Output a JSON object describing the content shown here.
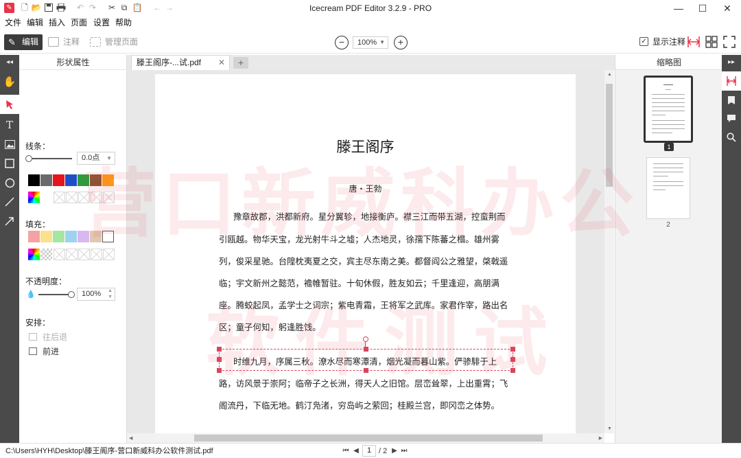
{
  "titlebar": {
    "title": "Icecream PDF Editor 3.2.9 - PRO",
    "logo_glyph": "✎",
    "quick_actions": [
      "new-file-icon",
      "open-folder-icon",
      "save-icon",
      "print-icon",
      "undo-icon",
      "redo-icon",
      "cut-icon",
      "copy-icon",
      "paste-icon",
      "back-icon",
      "forward-icon"
    ],
    "window_buttons": [
      "minimize-icon",
      "maximize-icon",
      "close-icon"
    ]
  },
  "menu": [
    "文件",
    "编辑",
    "插入",
    "页面",
    "设置",
    "帮助"
  ],
  "toolbar": {
    "edit_label": "编辑",
    "annotate_label": "注释",
    "manage_pages_label": "管理页面",
    "zoom_value": "100%",
    "show_notes_label": "显示注释",
    "show_notes_checked": true
  },
  "shape_panel": {
    "title": "形状属性",
    "stroke_label": "线条：",
    "stroke_width": "0.0点",
    "stroke_colors": [
      "#000000",
      "#6b6b6b",
      "#e8141d",
      "#1f4fc8",
      "#2f9b3a",
      "#8b5336",
      "#ff9a14"
    ],
    "fill_label": "填充：",
    "fill_colors": [
      "#f4a3a3",
      "#fde08a",
      "#a6e6a0",
      "#9fd2f0",
      "#d9b8f0",
      "#e0c8b0",
      "#ffffff"
    ],
    "opacity_label": "不透明度：",
    "opacity_value": "100%",
    "opacity_level": 1.0,
    "arrange_label": "安排：",
    "send_back_label": "往后退",
    "bring_forward_label": "前进"
  },
  "tab": {
    "label": "滕王阁序-...试.pdf"
  },
  "document": {
    "title": "滕王阁序",
    "author": "唐・王勃",
    "lines": [
      "豫章故郡，洪都新府。星分翼轸，地接衡庐。襟三江而带五湖，控蛮荆而",
      "引瓯越。物华天宝，龙光射牛斗之墟；人杰地灵，徐孺下陈蕃之榻。雄州雾",
      "列，俊采星驰。台隍枕夷夏之交，宾主尽东南之美。都督阎公之雅望，棨戟遥",
      "临；宇文新州之懿范，襜帷暂驻。十旬休假，胜友如云；千里逢迎，高朋满",
      "座。腾蛟起凤，孟学士之词宗；紫电青霜，王将军之武库。家君作宰，路出名",
      "区；童子何知，躬逢胜饯。",
      "时维九月，序属三秋。潦水尽而寒潭清，烟光凝而暮山紫。俨骖騑于上",
      "路，访风景于崇阿；临帝子之长洲，得天人之旧馆。层峦耸翠，上出重霄；飞",
      "阁流丹，下临无地。鹤汀凫渚，穷岛屿之萦回；桂殿兰宫，即冈峦之体势。"
    ]
  },
  "watermark": {
    "line1": "营口新威科办公",
    "line2": "软件测试"
  },
  "thumbnails": {
    "title": "缩略图",
    "pages": [
      "1",
      "2"
    ]
  },
  "statusbar": {
    "file_path": "C:\\Users\\HYH\\Desktop\\滕王阁序-营口新威科办公软件测试.pdf",
    "current_page": "1",
    "total_pages": "/ 2"
  }
}
